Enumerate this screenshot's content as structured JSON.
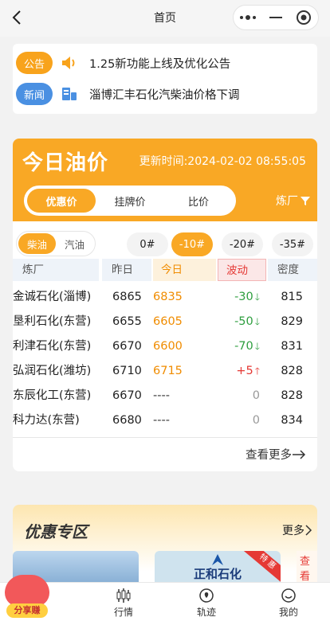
{
  "nav": {
    "title": "首页"
  },
  "notices": [
    {
      "tag": "公告",
      "text": "1.25新功能上线及优化公告"
    },
    {
      "tag": "新闻",
      "text": "淄博汇丰石化汽柴油价格下调"
    }
  ],
  "price": {
    "title": "今日油价",
    "update_time": "更新时间:2024-02-02 08:55:05",
    "tabs": [
      "优惠价",
      "挂牌价",
      "比价"
    ],
    "active_tab": "优惠价",
    "refinery_filter": "炼厂",
    "fuel_types": [
      "柴油",
      "汽油"
    ],
    "active_fuel": "柴油",
    "grades": [
      "0#",
      "-10#",
      "-20#",
      "-35#"
    ],
    "active_grade": "-10#",
    "columns": {
      "name": "炼厂",
      "yesterday": "昨日",
      "today": "今日",
      "change": "波动",
      "density": "密度"
    },
    "rows": [
      {
        "name": "金诚石化(淄博)",
        "yesterday": "6865",
        "today": "6835",
        "change": "-30",
        "dir": "down",
        "density": "815"
      },
      {
        "name": "垦利石化(东营)",
        "yesterday": "6655",
        "today": "6605",
        "change": "-50",
        "dir": "down",
        "density": "829"
      },
      {
        "name": "利津石化(东营)",
        "yesterday": "6670",
        "today": "6600",
        "change": "-70",
        "dir": "down",
        "density": "831"
      },
      {
        "name": "弘润石化(潍坊)",
        "yesterday": "6710",
        "today": "6715",
        "change": "+5",
        "dir": "up",
        "density": "828"
      },
      {
        "name": "东辰化工(东营)",
        "yesterday": "6670",
        "today": "----",
        "change": "0",
        "dir": "flat",
        "density": "828"
      },
      {
        "name": "科力达(东营)",
        "yesterday": "6680",
        "today": "----",
        "change": "0",
        "dir": "flat",
        "density": "834"
      }
    ],
    "see_more": "查看更多"
  },
  "promo": {
    "title": "优惠专区",
    "more": "更多",
    "card2_name": "正和石化",
    "card2_tag": "特 惠",
    "card3_text": "查看"
  },
  "tabbar": {
    "share": "分享赚",
    "items": [
      "行情",
      "轨迹",
      "我的"
    ]
  },
  "colors": {
    "accent": "#f9a825",
    "down": "#2e9e3f",
    "up": "#e53935"
  }
}
